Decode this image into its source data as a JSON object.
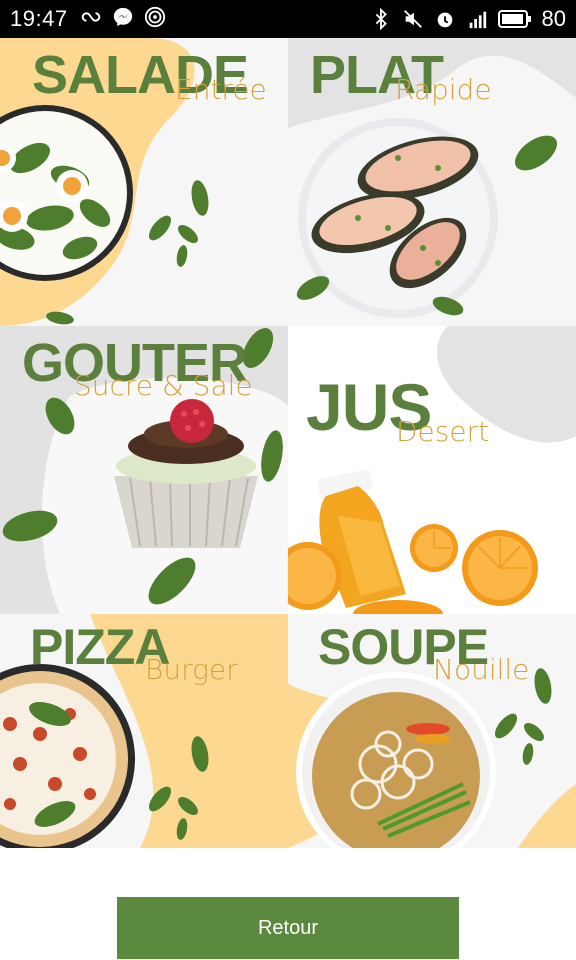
{
  "status_bar": {
    "time": "19:47",
    "battery": "80",
    "left_icons": [
      "link-icon",
      "messenger-icon",
      "hotspot-icon"
    ],
    "right_icons": [
      "bluetooth-icon",
      "mute-icon",
      "alarm-icon",
      "signal-4g-icon",
      "battery-icon"
    ]
  },
  "menu": {
    "tiles": [
      {
        "title": "SALADE",
        "subtitle": "Entrée",
        "image": "salad-plate"
      },
      {
        "title": "PLAT",
        "subtitle": "Rapide",
        "image": "stuffed-eggplant-plate"
      },
      {
        "title": "GOUTER",
        "subtitle": "Sucre & Sale",
        "image": "cupcake"
      },
      {
        "title": "JUS",
        "subtitle": "Desert",
        "image": "orange-juice-bottle"
      },
      {
        "title": "PIZZA",
        "subtitle": "Burger",
        "image": "pizza"
      },
      {
        "title": "SOUPE",
        "subtitle": "Nouille",
        "image": "noodle-soup-bowl"
      }
    ]
  },
  "colors": {
    "title_green": "#5b7f3d",
    "subtitle_gold": "#d4a23d",
    "button_green": "#5b8a3e",
    "blob_yellow": "#fcd890",
    "blob_grey": "#e3e3e3"
  },
  "footer": {
    "back_label": "Retour"
  }
}
